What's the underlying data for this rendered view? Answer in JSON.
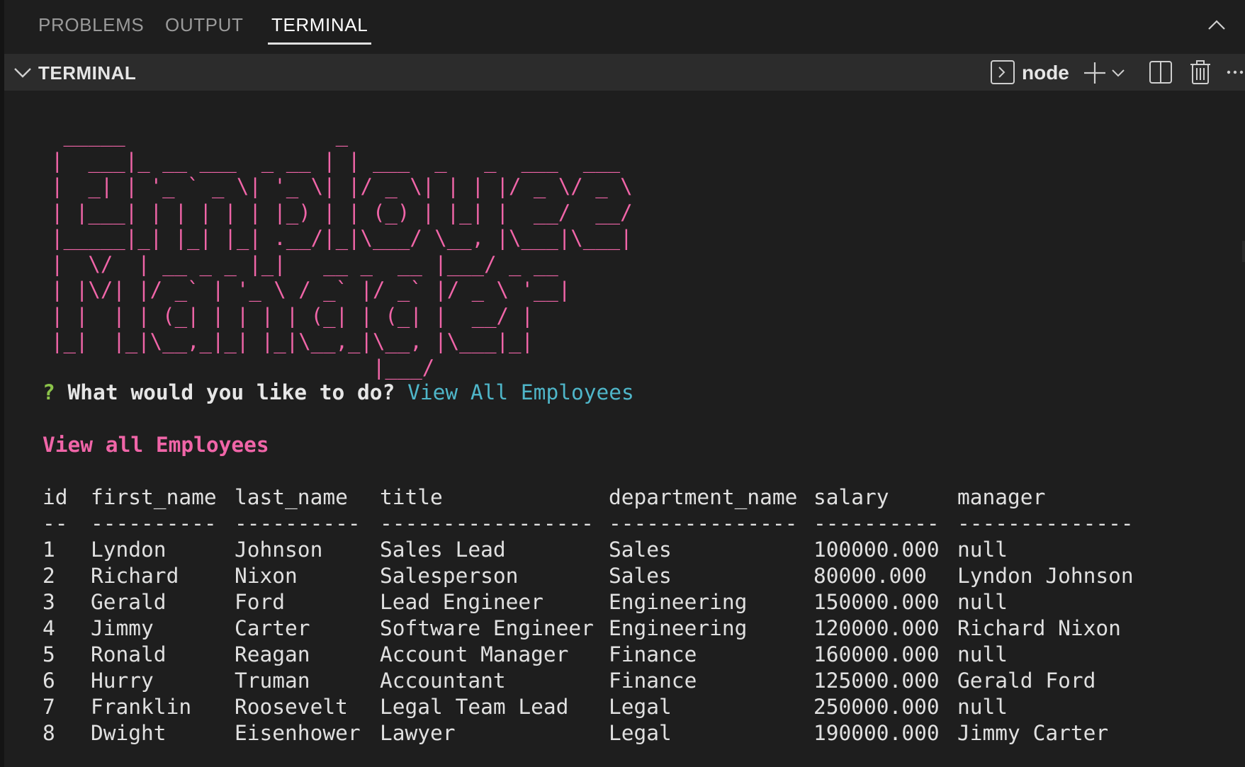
{
  "tabs": [
    {
      "label": "PROBLEMS",
      "active": false
    },
    {
      "label": "OUTPUT",
      "active": false
    },
    {
      "label": "TERMINAL",
      "active": true
    }
  ],
  "terminal_header": {
    "title": "TERMINAL",
    "shell": "node",
    "icons": [
      "terminal-icon",
      "plus-icon",
      "chevron-down-icon",
      "split-icon",
      "trash-icon",
      "more-icon",
      "chevron-up-icon"
    ]
  },
  "banner": {
    "text": " _____                 _\n|  ___|_ __ ___  _ __ | | ___  _   _  ___  ___\n|  _| | '_ ` _ \\| '_ \\| |/ _ \\| | | |/ _ \\/ _ \\\n| |___| | | | | | |_) | | (_) | |_| |  __/  __/\n|_____|_| |_| |_| .__/|_|\\___/ \\__, |\\___|\\___|\n|  \\/  | __ _ _ |_|   __ _  __ |___/ _ __\n| |\\/| |/ _` | '_ \\ / _` |/ _` |/ _ \\ '__|\n| |  | | (_| | | | | (_| | (_| |  __/ |\n|_|  |_|\\__,_|_| |_|\\__,_|\\__, |\\___|_|\n                          |___/",
    "color": "#f065a8"
  },
  "prompt": {
    "mark": "?",
    "question": "What would you like to do?",
    "answer": "View All Employees"
  },
  "section_title": "View all Employees",
  "table": {
    "headers": [
      "id",
      "first_name",
      "last_name",
      "title",
      "department_name",
      "salary",
      "manager"
    ],
    "separators": [
      "--",
      "----------",
      "----------",
      "-----------------",
      "---------------",
      "----------",
      "--------------"
    ],
    "rows": [
      [
        "1",
        "Lyndon",
        "Johnson",
        "Sales Lead",
        "Sales",
        "100000.000",
        "null"
      ],
      [
        "2",
        "Richard",
        "Nixon",
        "Salesperson",
        "Sales",
        "80000.000",
        "Lyndon Johnson"
      ],
      [
        "3",
        "Gerald",
        "Ford",
        "Lead Engineer",
        "Engineering",
        "150000.000",
        "null"
      ],
      [
        "4",
        "Jimmy",
        "Carter",
        "Software Engineer",
        "Engineering",
        "120000.000",
        "Richard Nixon"
      ],
      [
        "5",
        "Ronald",
        "Reagan",
        "Account Manager",
        "Finance",
        "160000.000",
        "null"
      ],
      [
        "6",
        "Hurry",
        "Truman",
        "Accountant",
        "Finance",
        "125000.000",
        "Gerald Ford"
      ],
      [
        "7",
        "Franklin",
        "Roosevelt",
        "Legal Team Lead",
        "Legal",
        "250000.000",
        "null"
      ],
      [
        "8",
        "Dwight",
        "Eisenhower",
        "Lawyer",
        "Legal",
        "190000.000",
        "Jimmy Carter"
      ]
    ]
  }
}
